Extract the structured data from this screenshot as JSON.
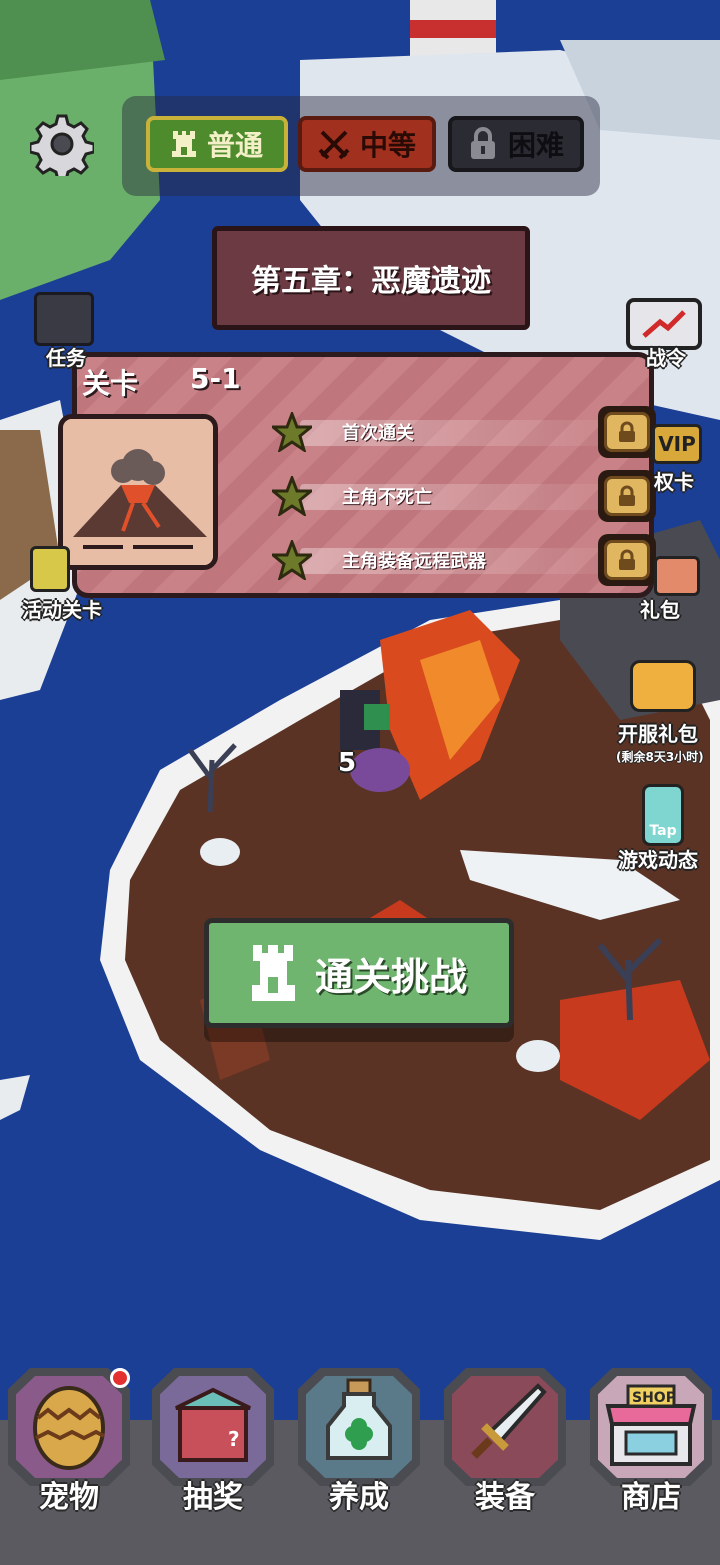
{
  "difficulty": {
    "normal": "普通",
    "medium": "中等",
    "hard": "困难"
  },
  "chapter": {
    "title": "第五章：恶魔遗迹"
  },
  "level": {
    "label": "关卡",
    "number": "5-1",
    "goals": [
      {
        "text": "首次通关"
      },
      {
        "text": "主角不死亡"
      },
      {
        "text": "主角装备远程武器"
      }
    ]
  },
  "side_menu": {
    "task": "任务",
    "battle_pass": "战令",
    "vip": "VIP",
    "privilege_card": "权卡",
    "event_level": "活动关卡",
    "gift": "礼包",
    "server_gift": "开服礼包",
    "server_gift_timer": "(剩余8天3小时)",
    "game_news": "游戏动态",
    "tap": "Tap",
    "player_level": "5"
  },
  "challenge_button": "通关挑战",
  "nav": {
    "pet": "宠物",
    "lottery": "抽奖",
    "cultivate": "养成",
    "equipment": "装备",
    "shop": "商店",
    "shop_sign": "SHOP"
  },
  "colors": {
    "ocean": "#1b3f95",
    "normal_tab": "#4e8b2c",
    "medium_tab": "#a2301e",
    "hard_tab": "#2b2b33",
    "panel": "#c98287",
    "challenge": "#6fb56f"
  }
}
